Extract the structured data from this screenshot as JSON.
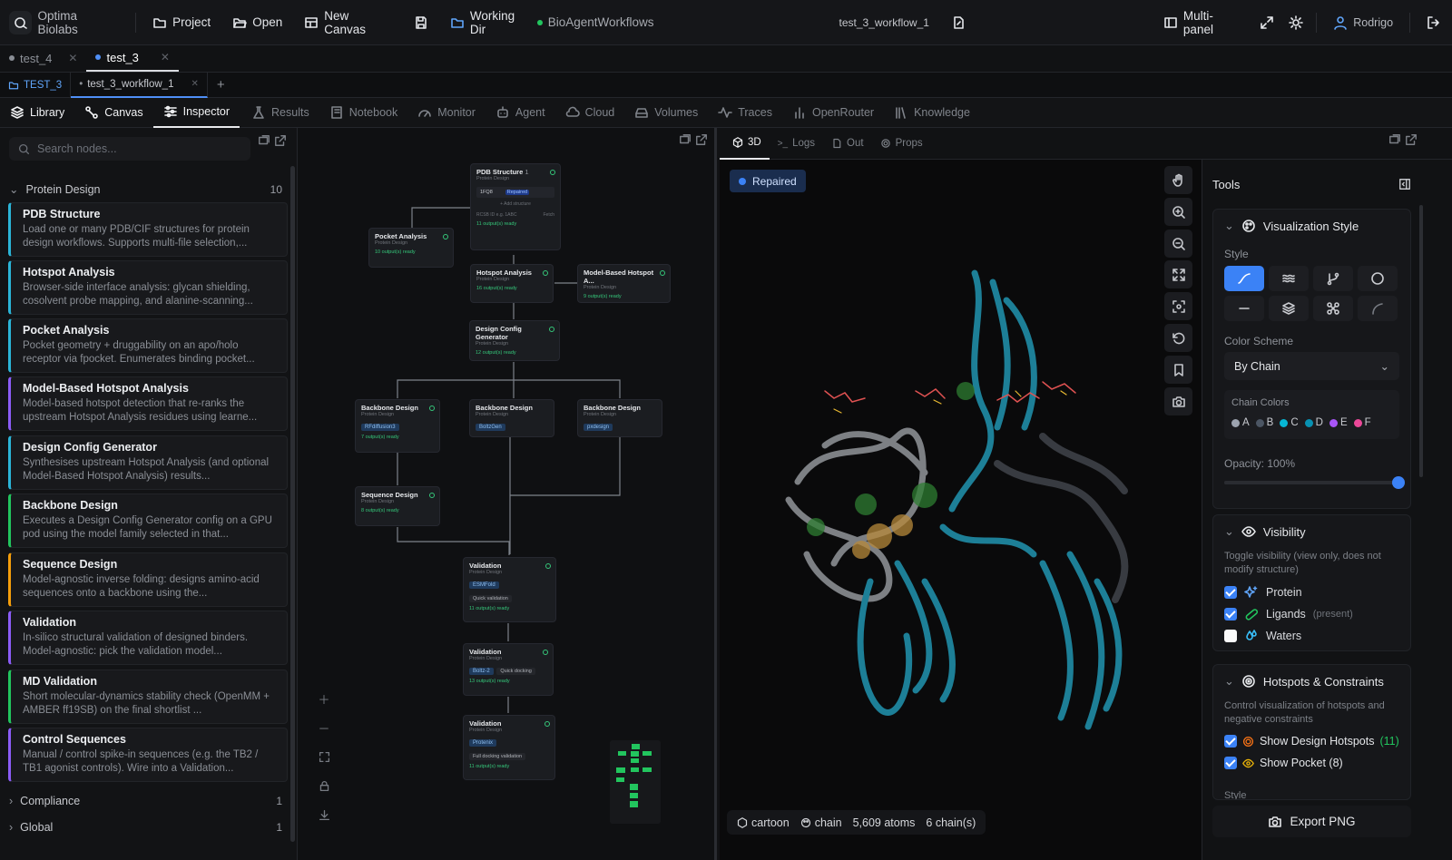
{
  "topbar": {
    "brand": "Optima Biolabs",
    "project": "Project",
    "open": "Open",
    "new_canvas": "New Canvas",
    "working_dir_label": "Working Dir",
    "working_dir_value": "BioAgentWorkflows",
    "workflow_name": "test_3_workflow_1",
    "multipanel": "Multi-panel",
    "user": "Rodrigo"
  },
  "file_tabs": [
    {
      "label": "test_4",
      "dot_color": "#8a8e95"
    },
    {
      "label": "test_3",
      "dot_color": "#4f8ff7"
    }
  ],
  "workflow_tabs": {
    "project_tag": "TEST_3",
    "workflow": "test_3_workflow_1",
    "add": "+"
  },
  "nav": [
    "Library",
    "Canvas",
    "Inspector",
    "Results",
    "Notebook",
    "Monitor",
    "Agent",
    "Cloud",
    "Volumes",
    "Traces",
    "OpenRouter",
    "Knowledge"
  ],
  "library": {
    "search_placeholder": "Search nodes...",
    "category": {
      "name": "Protein Design",
      "count": "10"
    },
    "nodes": [
      {
        "title": "PDB Structure",
        "desc": "Load one or many PDB/CIF structures for protein design workflows. Supports multi-file selection,...",
        "color": "#2bb5d8"
      },
      {
        "title": "Hotspot Analysis",
        "desc": "Browser-side interface analysis: glycan shielding, cosolvent probe mapping, and alanine-scanning...",
        "color": "#2bb5d8"
      },
      {
        "title": "Pocket Analysis",
        "desc": "Pocket geometry + druggability on an apo/holo receptor via fpocket. Enumerates binding pocket...",
        "color": "#2bb5d8"
      },
      {
        "title": "Model-Based Hotspot Analysis",
        "desc": "Model-based hotspot detection that re-ranks the upstream Hotspot Analysis residues using learne...",
        "color": "#8b5cf6"
      },
      {
        "title": "Design Config Generator",
        "desc": "Synthesises upstream Hotspot Analysis (and optional Model-Based Hotspot Analysis) results...",
        "color": "#2bb5d8"
      },
      {
        "title": "Backbone Design",
        "desc": "Executes a Design Config Generator config on a GPU pod using the model family selected in that...",
        "color": "#22c55e"
      },
      {
        "title": "Sequence Design",
        "desc": "Model-agnostic inverse folding: designs amino-acid sequences onto a backbone using the...",
        "color": "#f59e0b"
      },
      {
        "title": "Validation",
        "desc": "In-silico structural validation of designed binders. Model-agnostic: pick the validation model...",
        "color": "#8b5cf6"
      },
      {
        "title": "MD Validation",
        "desc": "Short molecular-dynamics stability check (OpenMM + AMBER ff19SB) on the final shortlist ...",
        "color": "#22c55e"
      },
      {
        "title": "Control Sequences",
        "desc": "Manual / control spike-in sequences (e.g. the TB2 / TB1 agonist controls). Wire into a Validation...",
        "color": "#8b5cf6"
      }
    ],
    "other_categories": [
      {
        "name": "Compliance",
        "count": "1"
      },
      {
        "name": "Global",
        "count": "1"
      }
    ]
  },
  "canvas": {
    "nodes": {
      "pdb": {
        "title": "PDB Structure",
        "sub": "Protein Design",
        "badge": "1",
        "file": "1FQ8",
        "tag": "Repaired",
        "add": "+ Add structure",
        "rcsb": "RCSB ID e.g. 1ABC",
        "fetch": "Fetch",
        "ready": "11 output(s) ready"
      },
      "pocket": {
        "title": "Pocket Analysis",
        "sub": "Protein Design",
        "ready": "10 output(s) ready"
      },
      "hotspot": {
        "title": "Hotspot Analysis",
        "sub": "Protein Design",
        "ready": "16 output(s) ready"
      },
      "mbh": {
        "title": "Model-Based Hotspot A...",
        "sub": "Protein Design",
        "ready": "9 output(s) ready"
      },
      "dcg": {
        "title": "Design Config Generator",
        "sub": "Protein Design",
        "ready": "12 output(s) ready"
      },
      "bb1": {
        "title": "Backbone Design",
        "sub": "Protein Design",
        "chip": "RFdiffusion3",
        "ready": "7 output(s) ready"
      },
      "bb2": {
        "title": "Backbone Design",
        "sub": "Protein Design",
        "chip": "BoltzGen"
      },
      "bb3": {
        "title": "Backbone Design",
        "sub": "Protein Design",
        "chip": "pxdesign"
      },
      "seq": {
        "title": "Sequence Design",
        "sub": "Protein Design",
        "ready": "8 output(s) ready"
      },
      "val1": {
        "title": "Validation",
        "sub": "Protein Design",
        "chip": "ESMFold",
        "note": "Quick validation",
        "ready": "11 output(s) ready"
      },
      "val2": {
        "title": "Validation",
        "sub": "Protein Design",
        "chip": "Boltz-2",
        "note": "Quick docking",
        "ready": "13 output(s) ready"
      },
      "val3": {
        "title": "Validation",
        "sub": "Protein Design",
        "chip": "Protenix",
        "note": "Full docking validation",
        "ready": "11 output(s) ready"
      }
    }
  },
  "viewer": {
    "tabs": [
      "3D",
      "Logs",
      "Out",
      "Props"
    ],
    "status_badge": "Repaired",
    "footer": {
      "style": "cartoon",
      "color": "chain",
      "atoms": "5,609 atoms",
      "chains": "6 chain(s)"
    }
  },
  "tools": {
    "title": "Tools",
    "viz": {
      "title": "Visualization Style",
      "style_label": "Style",
      "color_scheme_label": "Color Scheme",
      "color_scheme_value": "By Chain",
      "chain_colors_label": "Chain Colors",
      "chains": [
        {
          "id": "A",
          "color": "#9ca3af"
        },
        {
          "id": "B",
          "color": "#4b5563"
        },
        {
          "id": "C",
          "color": "#06b6d4"
        },
        {
          "id": "D",
          "color": "#0891b2"
        },
        {
          "id": "E",
          "color": "#a855f7"
        },
        {
          "id": "F",
          "color": "#ec4899"
        }
      ],
      "opacity_label": "Opacity: 100%",
      "opacity": 1.0
    },
    "visibility": {
      "title": "Visibility",
      "desc": "Toggle visibility (view only, does not modify structure)",
      "protein": "Protein",
      "ligands": "Ligands",
      "ligands_note": "(present)",
      "waters": "Waters"
    },
    "hotspots": {
      "title": "Hotspots & Constraints",
      "desc": "Control visualization of hotspots and negative constraints",
      "show_hotspots": "Show Design Hotspots",
      "hotspot_count": "(11)",
      "show_pocket": "Show Pocket (8)",
      "style_cut": "Style"
    },
    "export": "Export PNG"
  }
}
